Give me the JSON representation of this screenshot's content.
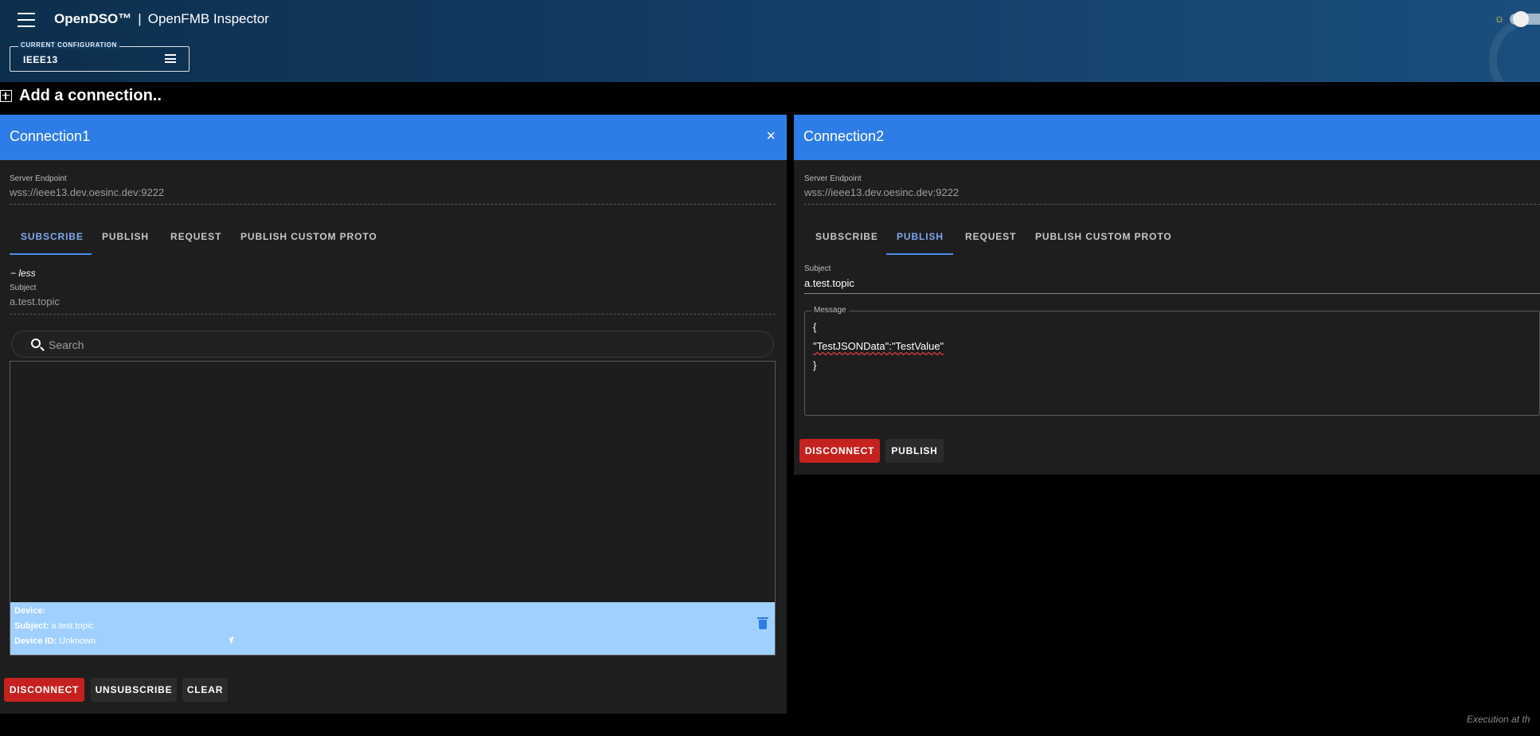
{
  "app": {
    "brand": "OpenDSO™",
    "separator": "|",
    "title": "OpenFMB Inspector",
    "config_label": "CURRENT CONFIGURATION",
    "config_value": "IEEE13"
  },
  "add_connection_label": "Add a connection..",
  "connections": [
    {
      "title": "Connection1",
      "close": "×",
      "endpoint_label": "Server Endpoint",
      "endpoint": "wss://ieee13.dev.oesinc.dev:9222",
      "tabs": [
        "SUBSCRIBE",
        "PUBLISH",
        "REQUEST",
        "PUBLISH CUSTOM PROTO"
      ],
      "active_tab": "SUBSCRIBE",
      "less_label": "− less",
      "subject_label": "Subject",
      "subject": "a.test.topic",
      "search_placeholder": "Search",
      "message": {
        "device_label": "Device:",
        "device": "",
        "subject_label": "Subject:",
        "subject": "a.test.topic",
        "device_id_label": "Device ID:",
        "device_id": "Unknown"
      },
      "buttons": {
        "disconnect": "DISCONNECT",
        "unsubscribe": "UNSUBSCRIBE",
        "clear": "CLEAR"
      }
    },
    {
      "title": "Connection2",
      "endpoint_label": "Server Endpoint",
      "endpoint": "wss://ieee13.dev.oesinc.dev:9222",
      "tabs": [
        "SUBSCRIBE",
        "PUBLISH",
        "REQUEST",
        "PUBLISH CUSTOM PROTO"
      ],
      "active_tab": "PUBLISH",
      "subject_label": "Subject",
      "subject": "a.test.topic",
      "message_label": "Message",
      "message_lines": [
        "{",
        "\"TestJSONData\":\"TestValue\"",
        "}"
      ],
      "buttons": {
        "disconnect": "DISCONNECT",
        "publish": "PUBLISH"
      }
    }
  ],
  "footer_note": "Execution at th",
  "colors": {
    "header_blue": "#2e7de6",
    "active_tab": "#7eaaf0",
    "disconnect_red": "#c5221f",
    "message_row": "#9fd0ff"
  },
  "icons": [
    "menu-icon",
    "sun-icon",
    "add-box-icon",
    "close-icon",
    "search-icon",
    "trash-icon"
  ]
}
